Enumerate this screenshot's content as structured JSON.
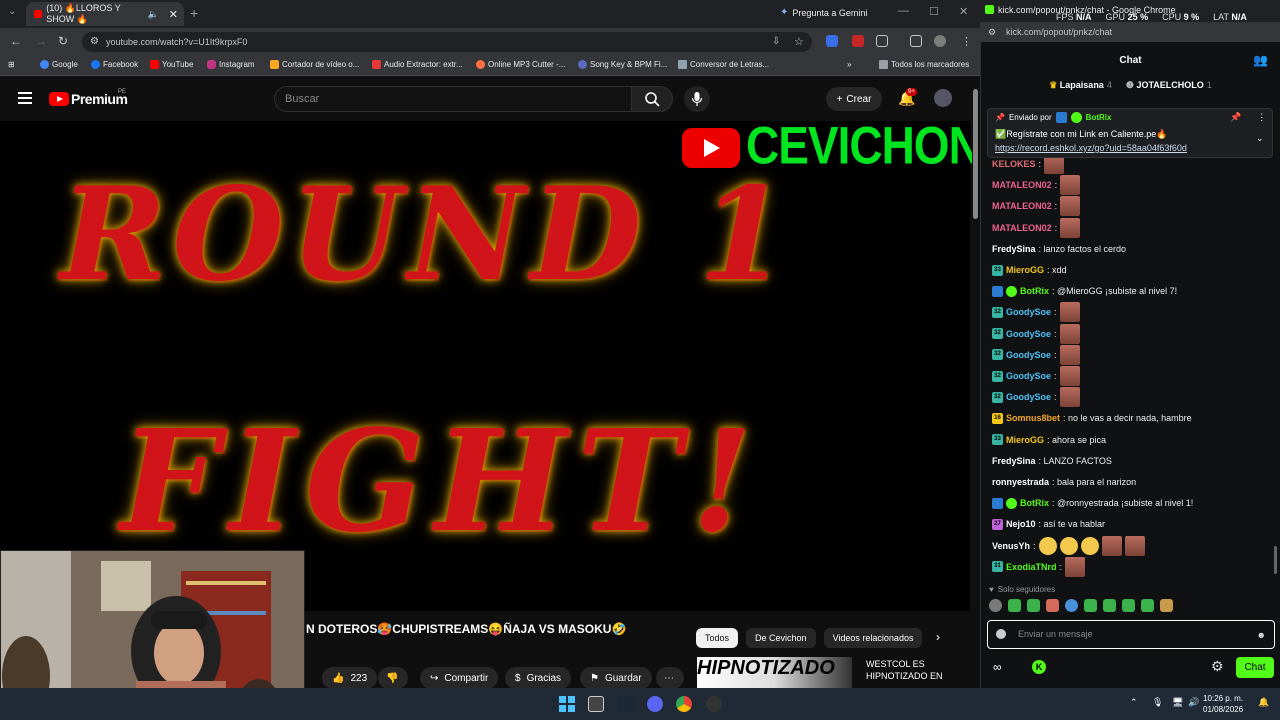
{
  "browser_left": {
    "tab_title": "(10) 🔥LLOROS Y SHOW 🔥",
    "gemini_label": "Pregunta a Gemini",
    "url": "youtube.com/watch?v=U1It9krpxF0",
    "bookmarks": [
      "Google",
      "Facebook",
      "YouTube",
      "Instagram",
      "Cortador de vídeo o...",
      "Audio Extractor: extr...",
      "Online MP3 Cutter -...",
      "Song Key & BPM Fi...",
      "Conversor de Letras..."
    ],
    "all_bookmarks": "Todos los marcadores"
  },
  "youtube": {
    "logo_text": "Premium",
    "country": "PE",
    "search_placeholder": "Buscar",
    "create_label": "Crear",
    "notif_badge": "9+",
    "video_brand": "CEVICHON",
    "video_text_1": "ROUND 1",
    "video_text_2": "FIGHT!",
    "video_title": "N DOTEROS🥵CHUPISTREAMS😝ÑAJA VS MASOKU🤣",
    "likes": "223",
    "share_label": "Compartir",
    "thanks_label": "Gracias",
    "save_label": "Guardar",
    "chips": [
      "Todos",
      "De Cevichon",
      "Videos relacionados"
    ],
    "rec_thumb_text": "HIPNOTIZADO",
    "rec_title": "WESTCOL ES HIPNOTIZADO EN"
  },
  "popup": {
    "window_title": "kick.com/popout/pnkz/chat - Google Chrome",
    "url": "kick.com/popout/pnkz/chat",
    "fps_label": "FPS",
    "fps_val": "N/A",
    "gpu_label": "GPU",
    "gpu_val": "25 %",
    "cpu_label": "CPU",
    "cpu_val": "9 %",
    "lat_label": "LAT",
    "lat_val": "N/A"
  },
  "chat": {
    "header": "Chat",
    "leader1_name": "Lapaisana",
    "leader1_count": "4",
    "leader2_name": "JOTAELCHOLO",
    "leader2_count": "1",
    "pinned_by": "Enviado por",
    "pinned_bot": "BotRix",
    "pinned_text": "✅Regístrate con mi Link en Caliente.pe🔥",
    "pinned_link": "https://record.eshkol.xyz/go?uid=58aa04f63f60d",
    "messages": [
      {
        "name": "KELOKES",
        "color": "#e06c75",
        "text": ":",
        "badge": "",
        "emotes": 1
      },
      {
        "name": "MATALEON02",
        "color": "#f06292",
        "text": ":",
        "badge": "",
        "emotes": 1
      },
      {
        "name": "MATALEON02",
        "color": "#f06292",
        "text": ":",
        "badge": "",
        "emotes": 1
      },
      {
        "name": "MATALEON02",
        "color": "#f06292",
        "text": ":",
        "badge": "",
        "emotes": 1
      },
      {
        "name": "FredySina",
        "color": "#ffffff",
        "text": ": lanzo factos el cerdo",
        "badge": "",
        "emotes": 0
      },
      {
        "name": "MieroGG",
        "color": "#f5c518",
        "text": ": xdd",
        "badge": "33",
        "emotes": 0
      },
      {
        "name": "BotRix",
        "color": "#53fc18",
        "text": ": @MieroGG ¡subiste al nivel 7!",
        "badge": "bot",
        "emotes": 0
      },
      {
        "name": "GoodySoe",
        "color": "#4fc3f7",
        "text": ":",
        "badge": "32",
        "emotes": 1
      },
      {
        "name": "GoodySoe",
        "color": "#4fc3f7",
        "text": ":",
        "badge": "32",
        "emotes": 1
      },
      {
        "name": "GoodySoe",
        "color": "#4fc3f7",
        "text": ":",
        "badge": "32",
        "emotes": 1
      },
      {
        "name": "GoodySoe",
        "color": "#4fc3f7",
        "text": ":",
        "badge": "32",
        "emotes": 1
      },
      {
        "name": "GoodySoe",
        "color": "#4fc3f7",
        "text": ":",
        "badge": "32",
        "emotes": 1
      },
      {
        "name": "Somnus8bet",
        "color": "#f5a623",
        "text": ": no le vas a decir nada, hambre",
        "badge": "16",
        "emotes": 0
      },
      {
        "name": "MieroGG",
        "color": "#f5c518",
        "text": ": ahora se pica",
        "badge": "33",
        "emotes": 0
      },
      {
        "name": "FredySina",
        "color": "#ffffff",
        "text": ": LANZO FACTOS",
        "badge": "",
        "emotes": 0
      },
      {
        "name": "ronnyestrada",
        "color": "#ffffff",
        "text": ": bala para el narizon",
        "badge": "",
        "emotes": 0
      },
      {
        "name": "BotRix",
        "color": "#53fc18",
        "text": ": @ronnyestrada ¡subiste al nivel 1!",
        "badge": "bot",
        "emotes": 0
      },
      {
        "name": "Nejo10",
        "color": "#ffffff",
        "text": ": así te va hablar",
        "badge": "27",
        "emotes": 0
      },
      {
        "name": "VenusYh",
        "color": "#ffffff",
        "text": ":",
        "badge": "",
        "emotes": 5
      },
      {
        "name": "ExodiaTNrd",
        "color": "#53fc18",
        "text": ":",
        "badge": "31",
        "emotes": 1
      }
    ],
    "followers_only": "Solo seguidores",
    "input_placeholder": "Enviar un mensaje",
    "send_label": "Chat"
  },
  "taskbar": {
    "time": "10:26 p. m.",
    "date": "01/08/2026"
  }
}
